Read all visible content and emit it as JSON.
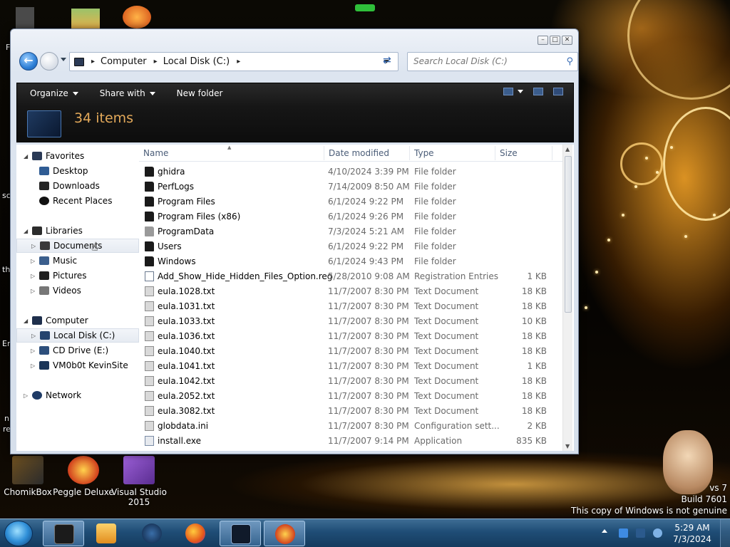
{
  "colors": {
    "toolbar_bg": "#161616",
    "item_count": "#e3a95a",
    "taskbar": "#1f4d76",
    "accent_blue": "#2e7fd6"
  },
  "desktop": {
    "icons": [
      {
        "label": "ChomikBox",
        "icon": "chomikbox-icon"
      },
      {
        "label": "Peggle Deluxe",
        "icon": "peggle-icon"
      },
      {
        "label": "Visual Studio 2015",
        "icon": "visual-studio-icon"
      }
    ],
    "watermark": {
      "line1": "vs 7",
      "line2": "Build 7601",
      "line3": "This copy of Windows is not genuine"
    },
    "edge_texts": [
      "F",
      "sc",
      "th",
      "Er",
      "n",
      "re"
    ]
  },
  "window": {
    "controls": {
      "minimize": "–",
      "maximize": "□",
      "close": "✕"
    },
    "address": {
      "crumbs": [
        "Computer",
        "Local Disk (C:)"
      ],
      "separator": "▸"
    },
    "search": {
      "placeholder": "Search Local Disk (C:)"
    },
    "toolbar": {
      "organize": "Organize",
      "share_with": "Share with",
      "new_folder": "New folder"
    },
    "banner": {
      "item_count": "34 items"
    }
  },
  "nav_pane": {
    "favorites": {
      "label": "Favorites",
      "items": [
        "Desktop",
        "Downloads",
        "Recent Places"
      ]
    },
    "libraries": {
      "label": "Libraries",
      "items": [
        "Documents",
        "Music",
        "Pictures",
        "Videos"
      ]
    },
    "computer": {
      "label": "Computer",
      "items": [
        "Local Disk (C:)",
        "CD Drive (E:)",
        "VM0b0t KevinSite"
      ]
    },
    "network": {
      "label": "Network"
    }
  },
  "file_list": {
    "columns": {
      "name": "Name",
      "date": "Date modified",
      "type": "Type",
      "size": "Size"
    },
    "rows": [
      {
        "name": "ghidra",
        "date": "4/10/2024 3:39 PM",
        "type": "File folder",
        "size": "",
        "icon": "folder-icon"
      },
      {
        "name": "PerfLogs",
        "date": "7/14/2009 8:50 AM",
        "type": "File folder",
        "size": "",
        "icon": "folder-icon"
      },
      {
        "name": "Program Files",
        "date": "6/1/2024 9:22 PM",
        "type": "File folder",
        "size": "",
        "icon": "folder-icon"
      },
      {
        "name": "Program Files (x86)",
        "date": "6/1/2024 9:26 PM",
        "type": "File folder",
        "size": "",
        "icon": "folder-icon"
      },
      {
        "name": "ProgramData",
        "date": "7/3/2024 5:21 AM",
        "type": "File folder",
        "size": "",
        "icon": "folder-hidden-icon"
      },
      {
        "name": "Users",
        "date": "6/1/2024 9:22 PM",
        "type": "File folder",
        "size": "",
        "icon": "folder-icon"
      },
      {
        "name": "Windows",
        "date": "6/1/2024 9:43 PM",
        "type": "File folder",
        "size": "",
        "icon": "folder-icon"
      },
      {
        "name": "Add_Show_Hide_Hidden_Files_Option.reg",
        "date": "5/28/2010 9:08 AM",
        "type": "Registration Entries",
        "size": "1 KB",
        "icon": "reg-file-icon"
      },
      {
        "name": "eula.1028.txt",
        "date": "11/7/2007 8:30 PM",
        "type": "Text Document",
        "size": "18 KB",
        "icon": "text-file-icon"
      },
      {
        "name": "eula.1031.txt",
        "date": "11/7/2007 8:30 PM",
        "type": "Text Document",
        "size": "18 KB",
        "icon": "text-file-icon"
      },
      {
        "name": "eula.1033.txt",
        "date": "11/7/2007 8:30 PM",
        "type": "Text Document",
        "size": "10 KB",
        "icon": "text-file-icon"
      },
      {
        "name": "eula.1036.txt",
        "date": "11/7/2007 8:30 PM",
        "type": "Text Document",
        "size": "18 KB",
        "icon": "text-file-icon"
      },
      {
        "name": "eula.1040.txt",
        "date": "11/7/2007 8:30 PM",
        "type": "Text Document",
        "size": "18 KB",
        "icon": "text-file-icon"
      },
      {
        "name": "eula.1041.txt",
        "date": "11/7/2007 8:30 PM",
        "type": "Text Document",
        "size": "1 KB",
        "icon": "text-file-icon"
      },
      {
        "name": "eula.1042.txt",
        "date": "11/7/2007 8:30 PM",
        "type": "Text Document",
        "size": "18 KB",
        "icon": "text-file-icon"
      },
      {
        "name": "eula.2052.txt",
        "date": "11/7/2007 8:30 PM",
        "type": "Text Document",
        "size": "18 KB",
        "icon": "text-file-icon"
      },
      {
        "name": "eula.3082.txt",
        "date": "11/7/2007 8:30 PM",
        "type": "Text Document",
        "size": "18 KB",
        "icon": "text-file-icon"
      },
      {
        "name": "globdata.ini",
        "date": "11/7/2007 8:30 PM",
        "type": "Configuration sett...",
        "size": "2 KB",
        "icon": "ini-file-icon"
      },
      {
        "name": "install.exe",
        "date": "11/7/2007 9:14 PM",
        "type": "Application",
        "size": "835 KB",
        "icon": "exe-file-icon"
      }
    ]
  },
  "taskbar": {
    "apps": [
      "explorer-icon",
      "media-player-icon",
      "browser-globe-icon",
      "firefox-icon",
      "window-app-icon",
      "peggle-icon"
    ],
    "clock": {
      "time": "5:29 AM",
      "date": "7/3/2024"
    }
  }
}
